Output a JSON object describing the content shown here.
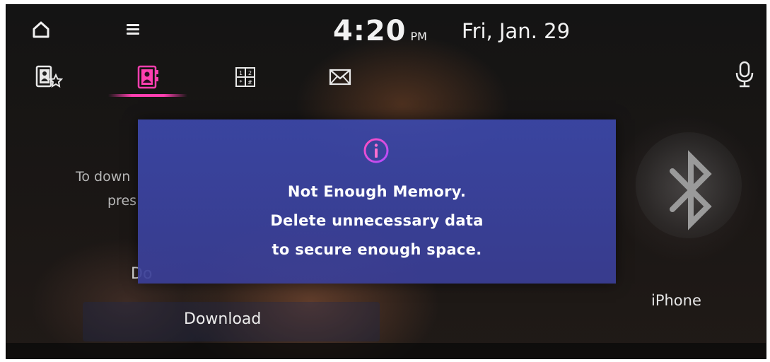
{
  "status_bar": {
    "time": "4:20",
    "ampm": "PM",
    "date": "Fri, Jan. 29"
  },
  "icons": {
    "home": "home-icon",
    "menu": "menu-icon",
    "favorites": "favorites-contacts-icon",
    "contacts": "contacts-icon",
    "dialpad": "dialpad-icon",
    "messages": "envelope-icon",
    "voice": "microphone-icon",
    "info": "info-icon",
    "bluetooth": "bluetooth-icon"
  },
  "background": {
    "hint_line1": "To down",
    "hint_line2": "pres",
    "download_clipped": "Do",
    "download_button": "Download",
    "device_name": "iPhone"
  },
  "popup": {
    "line1": "Not Enough Memory.",
    "line2": "Delete unnecessary data",
    "line3": "to secure enough space."
  },
  "colors": {
    "accent_pink": "#ff3fb0",
    "popup_blue": "#3c48aa",
    "text_white": "#ffffff"
  }
}
